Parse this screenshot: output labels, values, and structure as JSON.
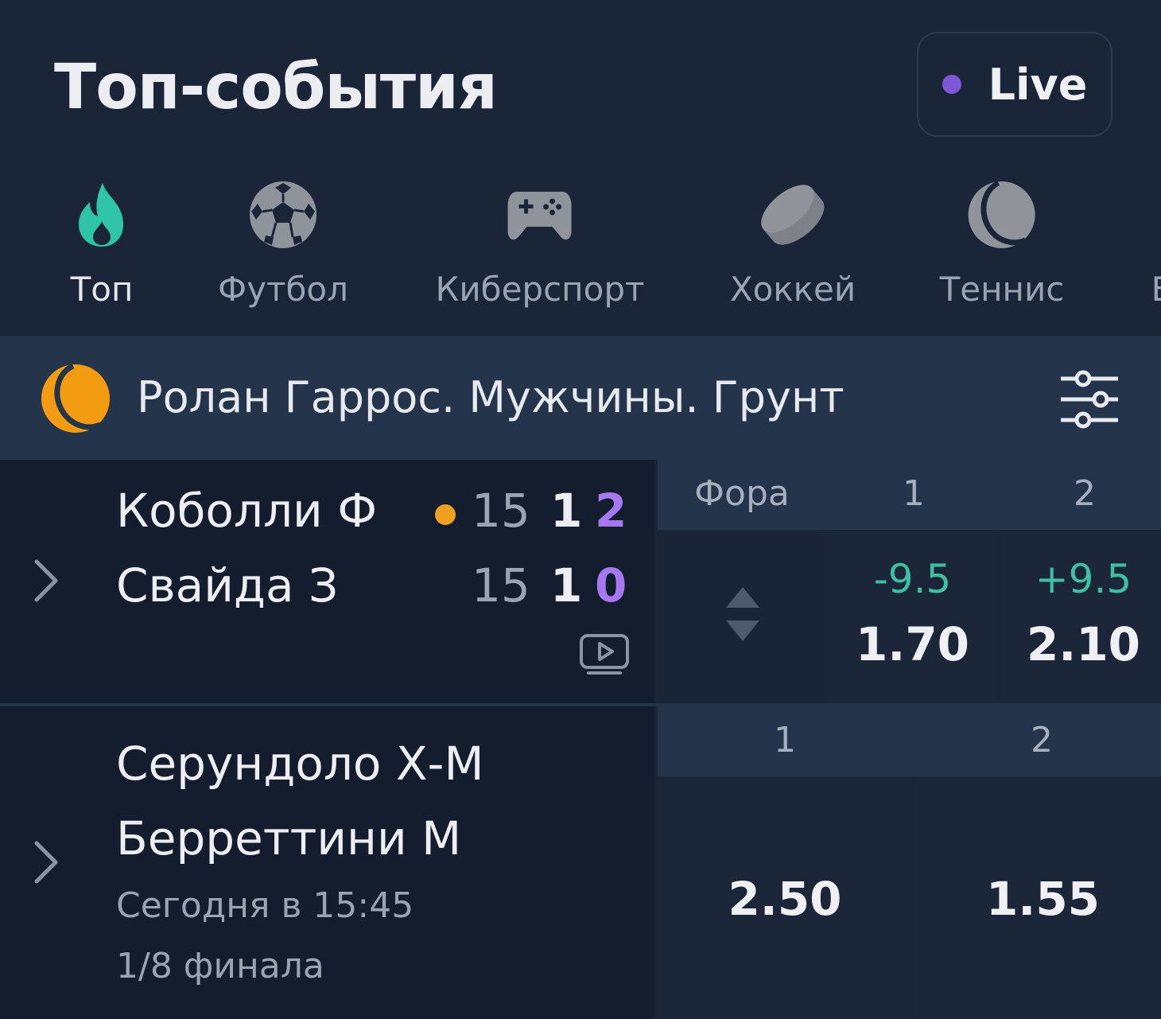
{
  "header": {
    "title": "Топ-события",
    "live_label": "Live",
    "live_dot_color": "#7d57d6"
  },
  "sport_tabs": [
    {
      "label": "Топ",
      "icon": "flame-icon",
      "active": true
    },
    {
      "label": "Футбол",
      "icon": "soccer-ball-icon",
      "active": false
    },
    {
      "label": "Киберспорт",
      "icon": "gamepad-icon",
      "active": false
    },
    {
      "label": "Хоккей",
      "icon": "hockey-puck-icon",
      "active": false
    },
    {
      "label": "Теннис",
      "icon": "tennis-ball-icon",
      "active": false
    },
    {
      "label": "В",
      "icon": "",
      "active": false
    }
  ],
  "league": {
    "title": "Ролан Гаррос. Мужчины. Грунт",
    "icon": "tennis-ball-icon",
    "icon_color": "#f39c12"
  },
  "matches": [
    {
      "team1": "Коболли Ф",
      "team2": "Свайда З",
      "score1": {
        "points": "15",
        "sets": "1",
        "games": "2"
      },
      "score2": {
        "points": "15",
        "sets": "1",
        "games": "0"
      },
      "serving": "team1",
      "market_label": "Фора",
      "col1_label": "1",
      "col2_label": "2",
      "odds": [
        {
          "line": "-9.5",
          "value": "1.70"
        },
        {
          "line": "+9.5",
          "value": "2.10"
        }
      ]
    },
    {
      "team1": "Серундоло Х-М",
      "team2": "Берреттини М",
      "time": "Сегодня в 15:45",
      "round": "1/8 финала",
      "col1_label": "1",
      "col2_label": "2",
      "odds": [
        {
          "value": "2.50"
        },
        {
          "value": "1.55"
        }
      ]
    }
  ]
}
